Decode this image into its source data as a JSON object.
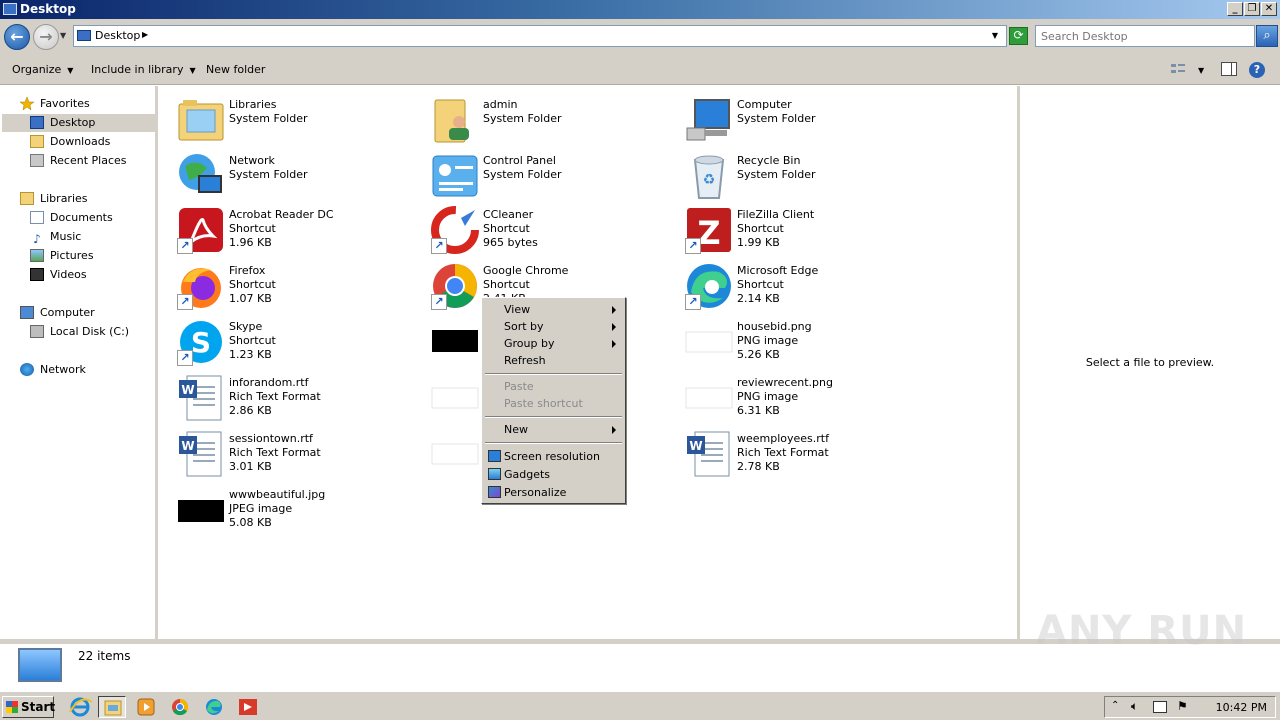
{
  "window": {
    "title": "Desktop"
  },
  "address": {
    "location": "Desktop",
    "search_placeholder": "Search Desktop"
  },
  "toolbar": {
    "organize": "Organize",
    "include_in_library": "Include in library",
    "new_folder": "New folder"
  },
  "nav": {
    "favorites": "Favorites",
    "desktop": "Desktop",
    "downloads": "Downloads",
    "recent_places": "Recent Places",
    "libraries": "Libraries",
    "documents": "Documents",
    "music": "Music",
    "pictures": "Pictures",
    "videos": "Videos",
    "computer": "Computer",
    "local_disk": "Local Disk (C:)",
    "network": "Network"
  },
  "files": [
    {
      "name": "Libraries",
      "type": "System Folder",
      "size": ""
    },
    {
      "name": "admin",
      "type": "System Folder",
      "size": ""
    },
    {
      "name": "Computer",
      "type": "System Folder",
      "size": ""
    },
    {
      "name": "Network",
      "type": "System Folder",
      "size": ""
    },
    {
      "name": "Control Panel",
      "type": "System Folder",
      "size": ""
    },
    {
      "name": "Recycle Bin",
      "type": "System Folder",
      "size": ""
    },
    {
      "name": "Acrobat Reader DC",
      "type": "Shortcut",
      "size": "1.96 KB"
    },
    {
      "name": "CCleaner",
      "type": "Shortcut",
      "size": "965 bytes"
    },
    {
      "name": "FileZilla Client",
      "type": "Shortcut",
      "size": "1.99 KB"
    },
    {
      "name": "Firefox",
      "type": "Shortcut",
      "size": "1.07 KB"
    },
    {
      "name": "Google Chrome",
      "type": "Shortcut",
      "size": "2.41 KB"
    },
    {
      "name": "Microsoft Edge",
      "type": "Shortcut",
      "size": "2.14 KB"
    },
    {
      "name": "Skype",
      "type": "Shortcut",
      "size": "1.23 KB"
    },
    {
      "name": "housebid.png",
      "type": "PNG image",
      "size": "5.26 KB"
    },
    {
      "name": "inforandom.rtf",
      "type": "Rich Text Format",
      "size": "2.86 KB"
    },
    {
      "name": "reviewrecent.png",
      "type": "PNG image",
      "size": "6.31 KB"
    },
    {
      "name": "sessiontown.rtf",
      "type": "Rich Text Format",
      "size": "3.01 KB"
    },
    {
      "name": "weemployees.rtf",
      "type": "Rich Text Format",
      "size": "2.78 KB"
    },
    {
      "name": "wwwbeautiful.jpg",
      "type": "JPEG image",
      "size": "5.08 KB"
    }
  ],
  "context_menu": {
    "view": "View",
    "sort_by": "Sort by",
    "group_by": "Group by",
    "refresh": "Refresh",
    "paste": "Paste",
    "paste_shortcut": "Paste shortcut",
    "new": "New",
    "screen_resolution": "Screen resolution",
    "gadgets": "Gadgets",
    "personalize": "Personalize"
  },
  "preview": {
    "text": "Select a file to preview."
  },
  "details": {
    "item_count": "22 items"
  },
  "watermark": "ANY RUN",
  "taskbar": {
    "start": "Start",
    "clock": "10:42 PM"
  },
  "colors": {
    "accent": "#3a6ea5",
    "chrome": "#d4d0c8",
    "selection": "#d4d0c8"
  }
}
